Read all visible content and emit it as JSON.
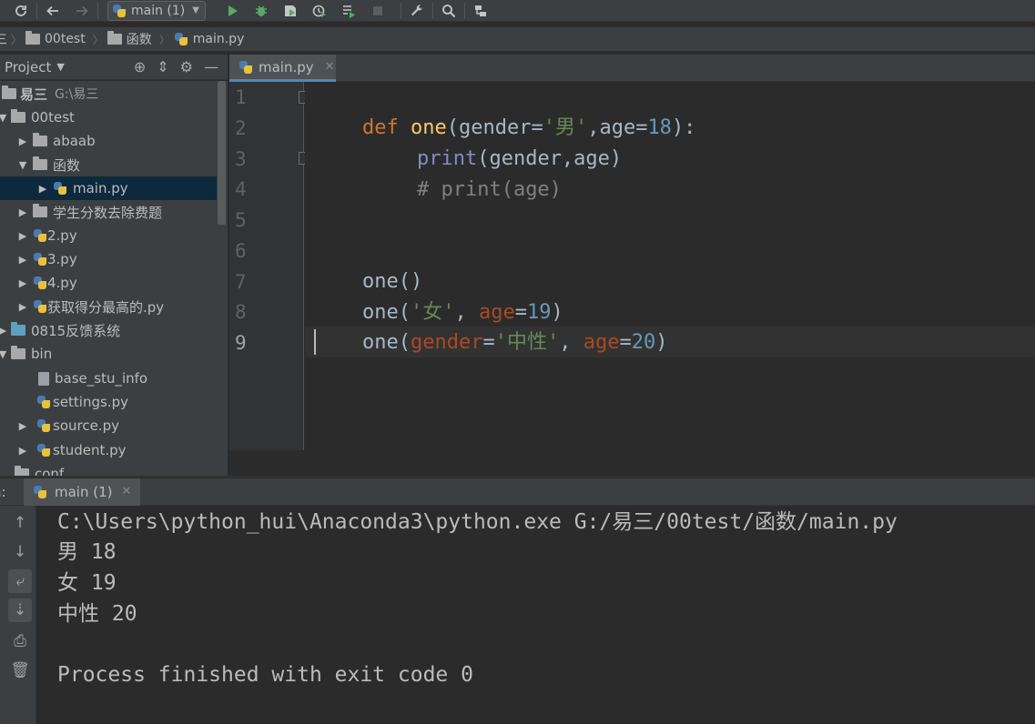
{
  "toolbar": {
    "run_config": "main (1)",
    "icons": [
      "sync-icon",
      "back-icon",
      "forward-icon",
      "run-icon",
      "debug-icon",
      "coverage-icon",
      "profile-icon",
      "run-list-icon",
      "stop-icon",
      "wrench-icon",
      "search-icon",
      "structure-icon"
    ]
  },
  "breadcrumb": {
    "items": [
      "00test",
      "函数",
      "main.py"
    ],
    "prefix": "三"
  },
  "project": {
    "title": "Project",
    "root": {
      "label": "易三",
      "path": "G:\\易三"
    },
    "items": [
      {
        "label": "00test"
      },
      {
        "label": "abaab"
      },
      {
        "label": "函数"
      },
      {
        "label": "main.py"
      },
      {
        "label": "学生分数去除费题"
      },
      {
        "label": "2.py"
      },
      {
        "label": "3.py"
      },
      {
        "label": "4.py"
      },
      {
        "label": "获取得分最高的.py"
      },
      {
        "label": "0815反馈系统"
      },
      {
        "label": "bin"
      },
      {
        "label": "base_stu_info"
      },
      {
        "label": "settings.py"
      },
      {
        "label": "source.py"
      },
      {
        "label": "student.py"
      },
      {
        "label": "conf"
      }
    ]
  },
  "editor": {
    "tab_label": "main.py",
    "line_numbers": [
      "1",
      "2",
      "3",
      "4",
      "5",
      "6",
      "7",
      "8",
      "9"
    ],
    "current_line": "9",
    "code": {
      "l1": {
        "kw": "def",
        "fn": "one",
        "p1": "(gender=",
        "s1": "'男'",
        "c1": ",",
        "p2": "age=",
        "n1": "18",
        "p3": "):"
      },
      "l2": {
        "bi": "print",
        "rest": "(gender,age)"
      },
      "l3": {
        "comment": "# print(age)"
      },
      "l6": {
        "text": "one()"
      },
      "l7": {
        "a": "one(",
        "s": "'女'",
        "b": ", ",
        "prm": "age",
        "eq": "=",
        "n": "19",
        "c": ")"
      },
      "l8": {
        "a": "one(",
        "prm1": "gender",
        "eq1": "=",
        "s": "'中性'",
        "b": ", ",
        "prm2": "age",
        "eq2": "=",
        "n": "20",
        "c": ")"
      }
    }
  },
  "run": {
    "label": "n:",
    "tab_label": "main (1)",
    "output": [
      "C:\\Users\\python_hui\\Anaconda3\\python.exe G:/易三/00test/函数/main.py",
      "男 18",
      "女 19",
      "中性 20",
      "",
      "Process finished with exit code 0"
    ]
  },
  "colors": {
    "background": "#2b2b2b",
    "panel": "#3c3f41",
    "keyword": "#cc7832",
    "function": "#ffc66d",
    "string": "#6a8759",
    "number": "#6897bb",
    "builtin": "#8888c6",
    "param": "#aa4926",
    "selection": "#0d293e"
  }
}
